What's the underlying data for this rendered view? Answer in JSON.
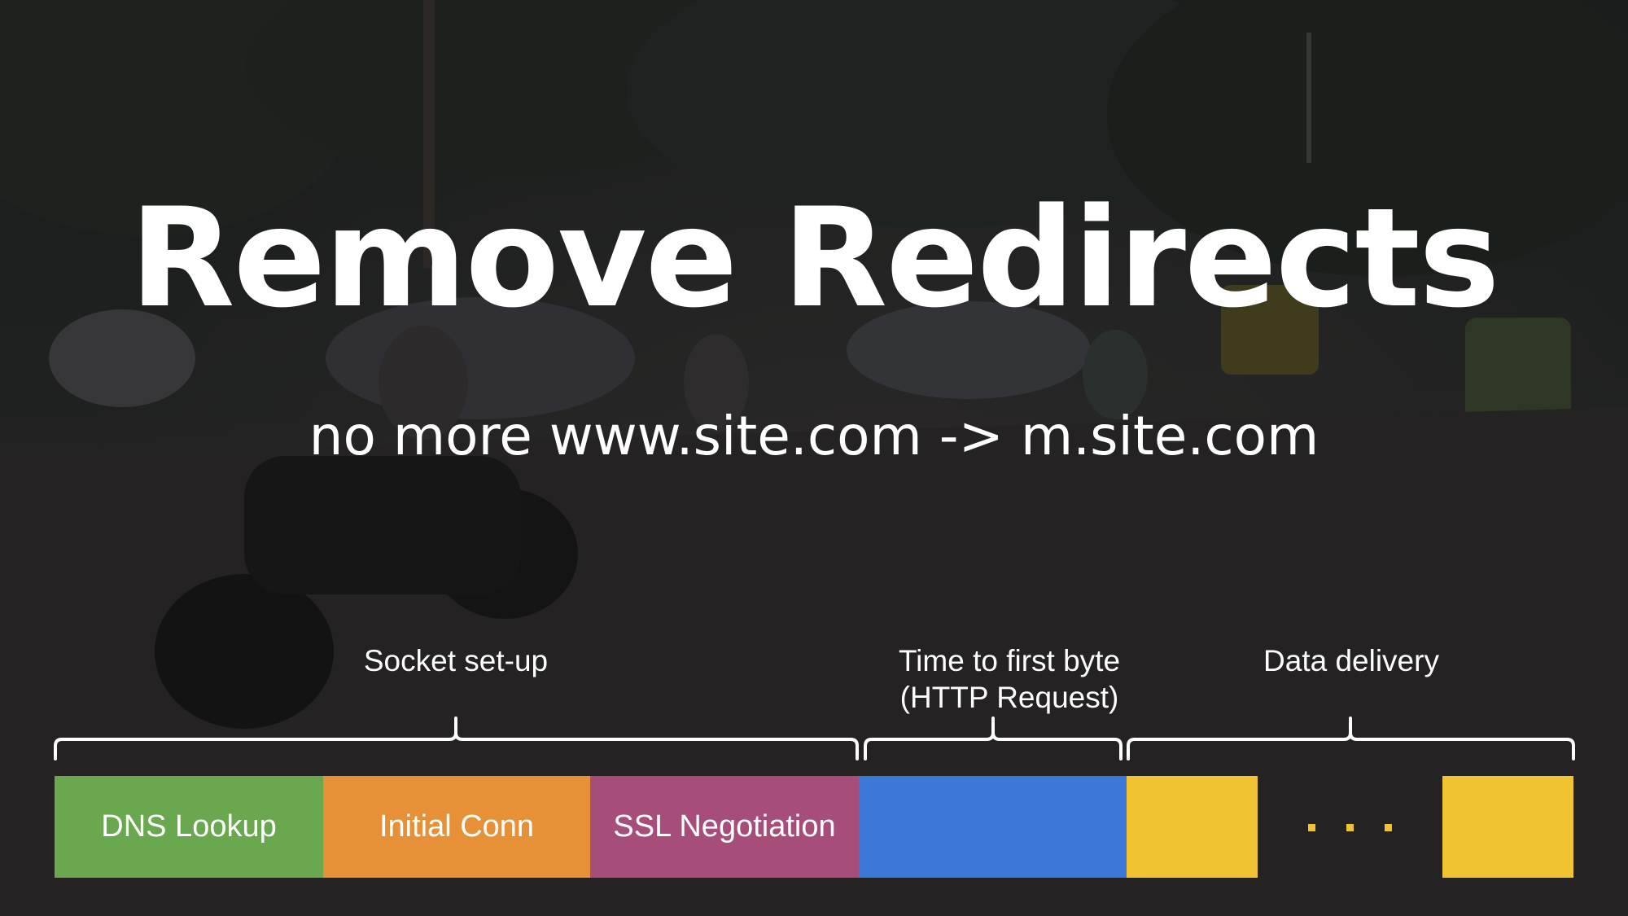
{
  "title": "Remove Redirects",
  "subtitle": "no more www.site.com -> m.site.com",
  "phases": {
    "socket": "Socket set-up",
    "ttfb_line1": "Time to first byte",
    "ttfb_line2": "(HTTP Request)",
    "delivery": "Data delivery"
  },
  "segments": {
    "dns": {
      "label": "DNS Lookup",
      "color": "#6aa84f"
    },
    "conn": {
      "label": "Initial Conn",
      "color": "#e69138"
    },
    "ssl": {
      "label": "SSL Negotiation",
      "color": "#a64d79"
    },
    "request": {
      "label": "",
      "color": "#3c78d8"
    },
    "data1": {
      "label": "",
      "color": "#f1c232"
    },
    "data2": {
      "label": "",
      "color": "#f1c232"
    }
  },
  "ellipsis_color": "#f1c232",
  "background": "dark photo of a street with motorcycles and cars"
}
